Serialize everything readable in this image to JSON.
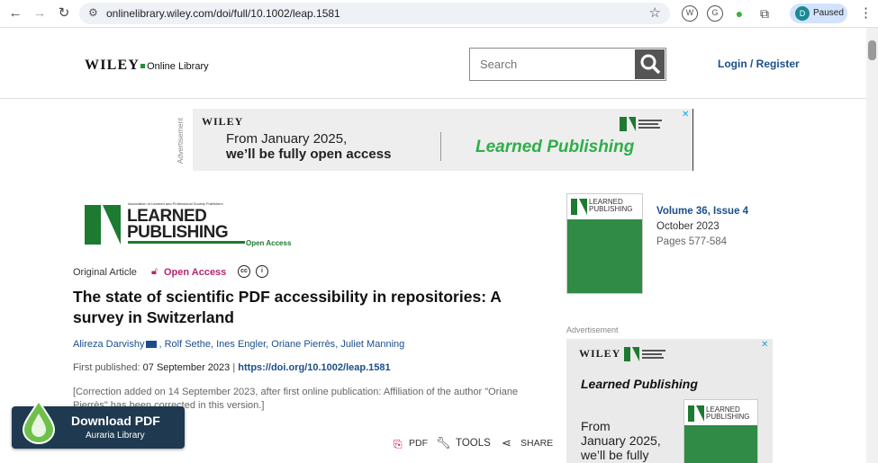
{
  "browser": {
    "url": "onlinelibrary.wiley.com/doi/full/10.1002/leap.1581",
    "profile_initial": "D",
    "profile_status": "Paused"
  },
  "header": {
    "logo_wordmark": "WILEY",
    "logo_sub": "Online Library",
    "search_placeholder": "Search",
    "login_label": "Login / Register"
  },
  "ad_top": {
    "vertical_label": "Advertisement",
    "brand": "WILEY",
    "line1": "From January 2025,",
    "line2": "we’ll be fully open access",
    "journal": "Learned Publishing",
    "close": "✕"
  },
  "journal_logo": {
    "tagline": "Association of Learned and Professional Society Publishers",
    "line1": "LEARNED",
    "line2": "PUBLISHING",
    "open_access": "Open Access"
  },
  "article": {
    "type": "Original Article",
    "access": "Open Access",
    "title": "The state of scientific PDF accessibility in repositories: A survey in Switzerland",
    "authors": [
      "Alireza Darvishy",
      "Rolf Sethe",
      "Ines Engler",
      "Oriane Pierrès",
      "Juliet Manning"
    ],
    "published_label": "First published:",
    "published_date": "07 September 2023",
    "separator": "|",
    "doi": "https://doi.org/10.1002/leap.1581",
    "correction": "[Correction added on 14 September 2023, after first online publication: Affiliation of the author \"Oriane Pierrès\" has been corrected in this version.]"
  },
  "tools": {
    "pdf": "PDF",
    "tools": "TOOLS",
    "share": "SHARE"
  },
  "download": {
    "title": "Download PDF",
    "library": "Auraria Library"
  },
  "issue": {
    "cover_title_1": "LEARNED",
    "cover_title_2": "PUBLISHING",
    "volume": "Volume 36, Issue 4",
    "date": "October 2023",
    "pages": "Pages 577-584"
  },
  "ad_side": {
    "label": "Advertisement",
    "brand": "WILEY",
    "journal": "Learned Publishing",
    "line1": "From",
    "line2": "January 2025,",
    "line3": "we’ll be fully",
    "cover_title_1": "LEARNED",
    "cover_title_2": "PUBLISHING",
    "close": "✕"
  },
  "colors": {
    "link": "#1b4e8a",
    "open_access": "#b4266f",
    "journal_green": "#1d7a31",
    "download_bg": "#1e3950"
  }
}
